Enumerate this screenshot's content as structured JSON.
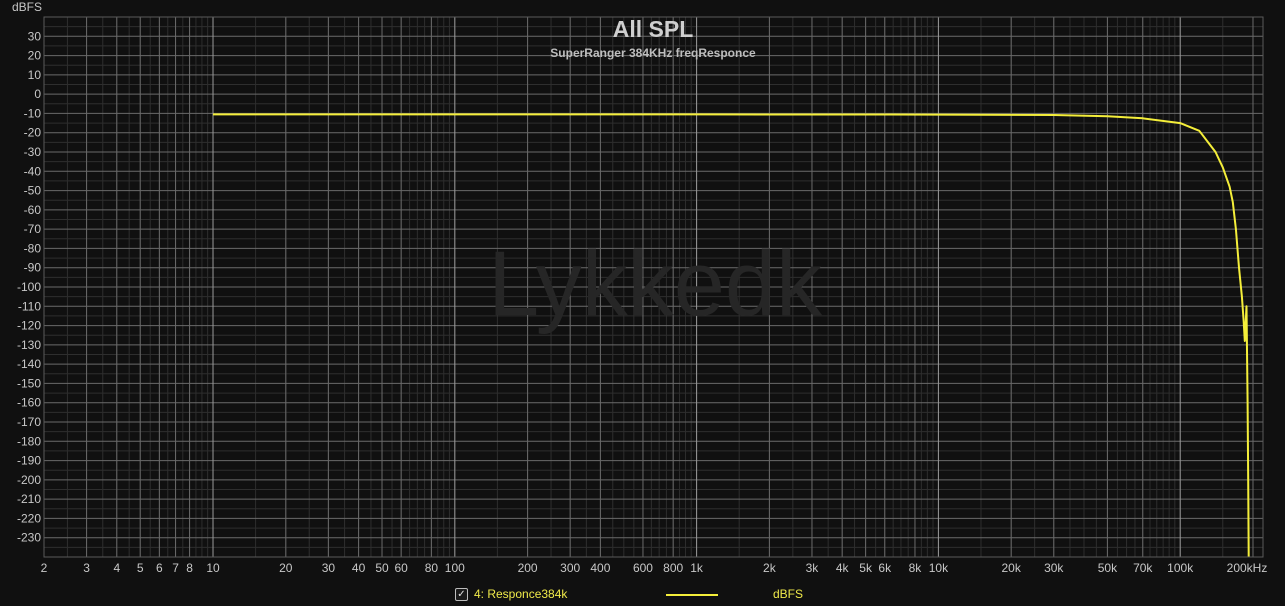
{
  "colors": {
    "background": "#101010",
    "grid_major": "#6a6a6a",
    "grid_minor": "#2e2e2e",
    "grid_decade": "#9a9a9a",
    "trace": "#f4ee3a",
    "text": "#c8c8c8",
    "title": "#cfcfcf",
    "watermark": "#262626"
  },
  "legend": {
    "checkbox": "✓",
    "series_label": "4: Responce384k",
    "unit_label": "dBFS"
  },
  "chart_data": {
    "type": "line",
    "title": "All SPL",
    "subtitle": "SuperRanger 384KHz freqResponce",
    "watermark": "Lykkedk",
    "ylabel": "dBFS",
    "xlabel": "",
    "x_scale": "log",
    "xlim": [
      2,
      220000
    ],
    "ylim": [
      -240,
      40
    ],
    "grid": true,
    "x_ticks": [
      {
        "v": 2,
        "label": "2"
      },
      {
        "v": 3,
        "label": "3"
      },
      {
        "v": 4,
        "label": "4"
      },
      {
        "v": 5,
        "label": "5"
      },
      {
        "v": 6,
        "label": "6"
      },
      {
        "v": 7,
        "label": "7"
      },
      {
        "v": 8,
        "label": "8"
      },
      {
        "v": 10,
        "label": "10"
      },
      {
        "v": 20,
        "label": "20"
      },
      {
        "v": 30,
        "label": "30"
      },
      {
        "v": 40,
        "label": "40"
      },
      {
        "v": 50,
        "label": "50"
      },
      {
        "v": 60,
        "label": "60"
      },
      {
        "v": 80,
        "label": "80"
      },
      {
        "v": 100,
        "label": "100"
      },
      {
        "v": 200,
        "label": "200"
      },
      {
        "v": 300,
        "label": "300"
      },
      {
        "v": 400,
        "label": "400"
      },
      {
        "v": 600,
        "label": "600"
      },
      {
        "v": 800,
        "label": "800"
      },
      {
        "v": 1000,
        "label": "1k"
      },
      {
        "v": 2000,
        "label": "2k"
      },
      {
        "v": 3000,
        "label": "3k"
      },
      {
        "v": 4000,
        "label": "4k"
      },
      {
        "v": 5000,
        "label": "5k"
      },
      {
        "v": 6000,
        "label": "6k"
      },
      {
        "v": 8000,
        "label": "8k"
      },
      {
        "v": 10000,
        "label": "10k"
      },
      {
        "v": 20000,
        "label": "20k"
      },
      {
        "v": 30000,
        "label": "30k"
      },
      {
        "v": 50000,
        "label": "50k"
      },
      {
        "v": 70000,
        "label": "70k"
      },
      {
        "v": 100000,
        "label": "100k"
      },
      {
        "v": 200000,
        "label": "200kHz"
      }
    ],
    "y_ticks": [
      30,
      20,
      10,
      0,
      -10,
      -20,
      -30,
      -40,
      -50,
      -60,
      -70,
      -80,
      -90,
      -100,
      -110,
      -120,
      -130,
      -140,
      -150,
      -160,
      -170,
      -180,
      -190,
      -200,
      -210,
      -220,
      -230
    ],
    "series": [
      {
        "name": "4: Responce384k",
        "x": [
          10,
          100,
          1000,
          10000,
          30000,
          50000,
          70000,
          100000,
          120000,
          140000,
          150000,
          160000,
          165000,
          170000,
          175000,
          180000,
          183000,
          185000,
          188000,
          190000,
          191000,
          192000
        ],
        "y": [
          -10.5,
          -10.5,
          -10.5,
          -10.6,
          -10.8,
          -11.5,
          -12.5,
          -15,
          -19,
          -30,
          -38,
          -48,
          -56,
          -70,
          -90,
          -105,
          -118,
          -128,
          -110,
          -160,
          -200,
          -240
        ]
      }
    ]
  }
}
